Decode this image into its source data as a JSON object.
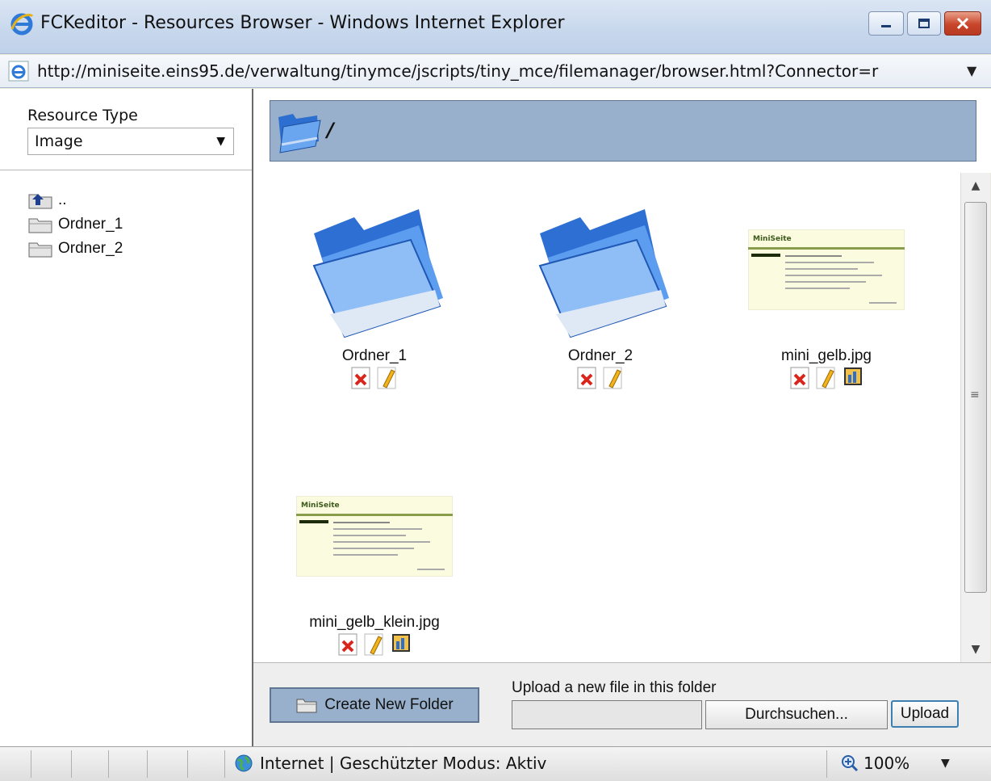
{
  "window": {
    "title": "FCKeditor - Resources Browser - Windows Internet Explorer",
    "address": "http://miniseite.eins95.de/verwaltung/tinymce/jscripts/tiny_mce/filemanager/browser.html?Connector=r"
  },
  "sidebar": {
    "resource_type_label": "Resource Type",
    "resource_type_value": "Image",
    "tree": [
      {
        "label": "..",
        "icon": "folder-up-icon"
      },
      {
        "label": "Ordner_1",
        "icon": "folder-icon"
      },
      {
        "label": "Ordner_2",
        "icon": "folder-icon"
      }
    ]
  },
  "path": {
    "current": "/"
  },
  "files": [
    {
      "name": "Ordner_1",
      "type": "folder"
    },
    {
      "name": "Ordner_2",
      "type": "folder"
    },
    {
      "name": "mini_gelb.jpg",
      "type": "image"
    },
    {
      "name": "mini_gelb_klein.jpg",
      "type": "image"
    }
  ],
  "thumbnail": {
    "site_title": "MiniSeite"
  },
  "bottom": {
    "create_folder_label": "Create New Folder",
    "upload_label": "Upload a new file in this folder",
    "browse_label": "Durchsuchen...",
    "upload_button": "Upload"
  },
  "status": {
    "zone": "Internet | Geschützter Modus: Aktiv",
    "zoom": "100%"
  },
  "colors": {
    "panel_blue": "#98b0cb",
    "folder_blue": "#3f7fd6"
  }
}
